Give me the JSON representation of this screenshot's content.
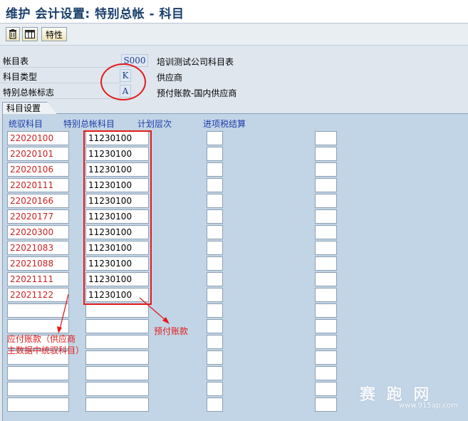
{
  "window": {
    "title": "维护 会计设置: 特别总帐 - 科目"
  },
  "toolbar": {
    "characteristics_label": "特性"
  },
  "header": {
    "chart_of_accounts": {
      "label": "帐目表",
      "value": "S000",
      "desc": "培训测试公司科目表"
    },
    "account_type": {
      "label": "科目类型",
      "value": "K",
      "desc": "供应商"
    },
    "special_gl_indicator": {
      "label": "特别总帐标志",
      "value": "A",
      "desc": "预付账款-国内供应商"
    }
  },
  "section": {
    "tab_label": "科目设置"
  },
  "columns": {
    "recon_account": "统驭科目",
    "special_gl_account": "特别总帐科目",
    "planning_level": "计划层次",
    "input_tax_clearing": "进项税结算"
  },
  "rows": [
    {
      "recon": "22020100",
      "special": "11230100"
    },
    {
      "recon": "22020101",
      "special": "11230100"
    },
    {
      "recon": "22020106",
      "special": "11230100"
    },
    {
      "recon": "22020111",
      "special": "11230100"
    },
    {
      "recon": "22020166",
      "special": "11230100"
    },
    {
      "recon": "22020177",
      "special": "11230100"
    },
    {
      "recon": "22020300",
      "special": "11230100"
    },
    {
      "recon": "22021083",
      "special": "11230100"
    },
    {
      "recon": "22021088",
      "special": "11230100"
    },
    {
      "recon": "22021111",
      "special": "11230100"
    },
    {
      "recon": "22021122",
      "special": "11230100"
    },
    {
      "recon": "",
      "special": ""
    },
    {
      "recon": "",
      "special": ""
    },
    {
      "recon": "",
      "special": ""
    },
    {
      "recon": "",
      "special": ""
    },
    {
      "recon": "",
      "special": ""
    },
    {
      "recon": "",
      "special": ""
    },
    {
      "recon": "",
      "special": ""
    }
  ],
  "annotations": {
    "payable_line1": "应付账款（供应商",
    "payable_line2": "主数据中统驭科目）",
    "prepaid": "预付账款"
  },
  "watermark": {
    "brand": "赛 跑 网",
    "site": "www.915ap.com"
  },
  "colors": {
    "title": "#1a3f6b",
    "recon_text": "#cc2222",
    "annotation": "#e21b1b",
    "panel_bg": "#c2d5e6"
  },
  "icons": [
    "delete-icon",
    "table-icon",
    "trash-icon"
  ]
}
